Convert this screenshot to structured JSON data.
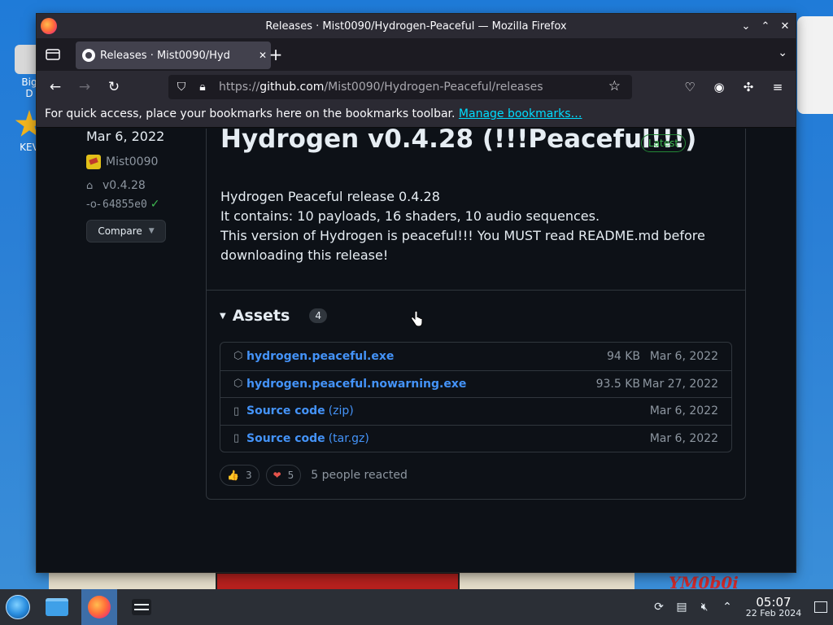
{
  "desktop": {
    "icons": [
      {
        "label": "Big\nD"
      },
      {
        "label": "KEV"
      }
    ],
    "wallpaper_text": "YM0b0i"
  },
  "window": {
    "title": "Releases · Mist0090/Hydrogen-Peaceful — Mozilla Firefox",
    "tab_label": "Releases · Mist0090/Hyd",
    "url_prefix": "https://",
    "url_host": "github.com",
    "url_path": "/Mist0090/Hydrogen-Peaceful/releases",
    "bookmarks_text": "For quick access, place your bookmarks here on the bookmarks toolbar.",
    "bookmarks_link": "Manage bookmarks…"
  },
  "release": {
    "date": "Mar 6, 2022",
    "author": "Mist0090",
    "tag": "v0.4.28",
    "commit": "64855e0",
    "compare_label": "Compare",
    "title": "Hydrogen v0.4.28 (!!!Peaceful!!!)",
    "badge": "Latest",
    "body": [
      "Hydrogen Peaceful release 0.4.28",
      "It contains: 10 payloads, 16 shaders, 10 audio sequences.",
      "This version of Hydrogen is peaceful!!! You MUST read README.md before downloading this release!"
    ],
    "assets_label": "Assets",
    "assets_count": "4",
    "assets": [
      {
        "name": "hydrogen.peaceful.exe",
        "suffix": "",
        "size": "94 KB",
        "date": "Mar 6, 2022"
      },
      {
        "name": "hydrogen.peaceful.nowarning.exe",
        "suffix": "",
        "size": "93.5 KB",
        "date": "Mar 27, 2022"
      },
      {
        "name": "Source code",
        "suffix": "(zip)",
        "size": "",
        "date": "Mar 6, 2022"
      },
      {
        "name": "Source code",
        "suffix": "(tar.gz)",
        "size": "",
        "date": "Mar 6, 2022"
      }
    ],
    "reactions": [
      {
        "emoji": "👍",
        "count": "3"
      },
      {
        "emoji": "❤",
        "count": "5"
      }
    ],
    "reactions_summary": "5 people reacted"
  },
  "taskbar": {
    "time": "05:07",
    "date": "22 Feb 2024"
  }
}
